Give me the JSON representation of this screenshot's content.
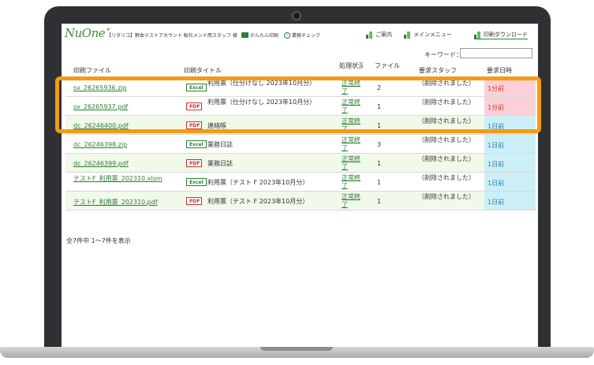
{
  "header": {
    "logo": "NuOne",
    "user_info": "【リタリコ】野本テストアカウント 販社メンテ用スタッフ 様",
    "easy_print": "かんたん印刷",
    "work_check": "業務チェック",
    "nav": {
      "guide": "ご案内",
      "main_menu": "メインメニュー",
      "download": "印刷ダウンロード"
    }
  },
  "search": {
    "label": "キーワード：",
    "value": ""
  },
  "table": {
    "headers": {
      "file": "印刷ファイル",
      "title": "印刷タイトル",
      "status": "処理状況",
      "count": "ファイル数",
      "staff": "要求スタッフ",
      "time": "要求日時"
    },
    "rows": [
      {
        "file": "sv_26265936.zip",
        "type": "Excel",
        "title": "利用票（仕分けなし 2023年10月分）",
        "status": "正常終了",
        "count": "2",
        "staff": "（削除されました）",
        "time": "1分前"
      },
      {
        "file": "sv_26265937.pdf",
        "type": "PDF",
        "title": "利用票（仕分けなし 2023年10月分）",
        "status": "正常終了",
        "count": "1",
        "staff": "（削除されました）",
        "time": "1分前"
      },
      {
        "file": "dc_26246400.pdf",
        "type": "PDF",
        "title": "連絡帳",
        "status": "正常終了",
        "count": "1",
        "staff": "（削除されました）",
        "time": "1日前"
      },
      {
        "file": "dc_26246398.zip",
        "type": "Excel",
        "title": "業務日誌",
        "status": "正常終了",
        "count": "3",
        "staff": "（削除されました）",
        "time": "1日前"
      },
      {
        "file": "dc_26246399.pdf",
        "type": "PDF",
        "title": "業務日誌",
        "status": "正常終了",
        "count": "1",
        "staff": "（削除されました）",
        "time": "1日前"
      },
      {
        "file": "テストF_利用票_202310.xlsm",
        "type": "Excel",
        "title": "利用票（テスト F 2023年10月分）",
        "status": "正常終了",
        "count": "1",
        "staff": "（削除されました）",
        "time": "1日前"
      },
      {
        "file": "テストF_利用票_202310.pdf",
        "type": "PDF",
        "title": "利用票（テスト F 2023年10月分）",
        "status": "正常終了",
        "count": "1",
        "staff": "（削除されました）",
        "time": "1日前"
      }
    ]
  },
  "summary": "全7件中 1～7件を表示",
  "colors": {
    "accent_green": "#2e7d32",
    "highlight": "#f39c12",
    "recent_time_bg": "#fbd0d6",
    "older_time_bg": "#cdeff7"
  }
}
